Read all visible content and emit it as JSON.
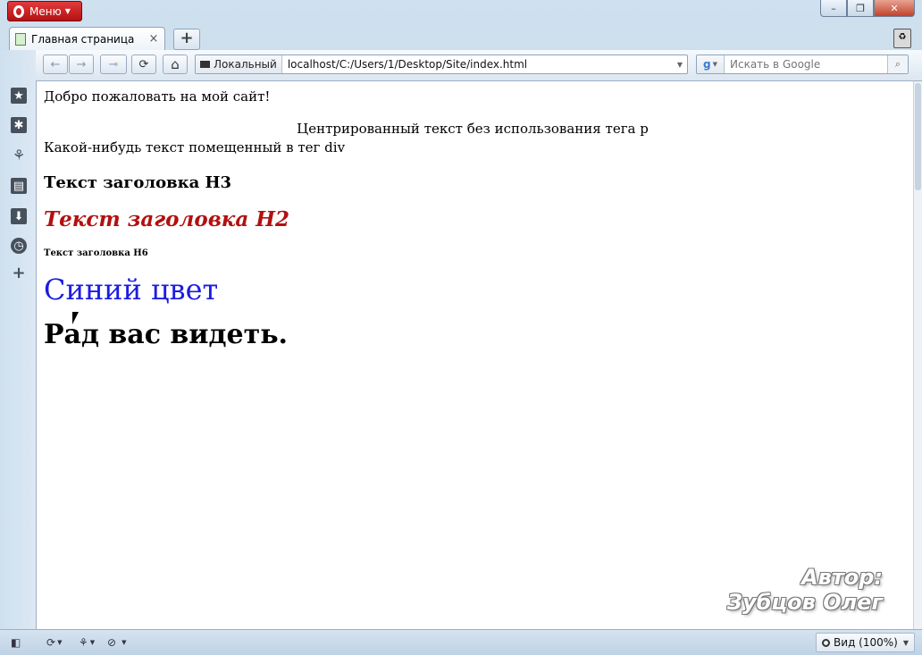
{
  "titlebar": {
    "menu_label": "Меню"
  },
  "window_controls": {
    "minimize": "–",
    "restore": "❐",
    "close": "✕"
  },
  "tabs": [
    {
      "label": "Главная страница",
      "close": "×"
    }
  ],
  "new_tab_label": "+",
  "toolbar": {
    "back": "←",
    "forward": "→",
    "key": "⊸",
    "reload": "⟳",
    "home": "⌂"
  },
  "address": {
    "security_label": "Локальный",
    "url": "localhost/C:/Users/1/Desktop/Site/index.html",
    "dropdown": "▼"
  },
  "search": {
    "engine_icon": "g",
    "placeholder": "Искать в Google",
    "button": "⌕"
  },
  "sidepanel": {
    "icons": [
      "bookmarks-icon",
      "widgets-icon",
      "unite-icon",
      "notes-icon",
      "downloads-icon",
      "history-icon",
      "add-panel-icon"
    ]
  },
  "page": {
    "welcome": "Добро пожаловать на мой сайт!",
    "centered": "Центрированный текст без использования тега p",
    "div_text": "Какой-нибудь текст помещенный в тег div",
    "h3": "Текст заголовка H3",
    "h2": "Текст заголовка H2",
    "h6": "Текст заголовка H6",
    "blue": "Синий цвет",
    "big": "Рад вас видеть."
  },
  "watermark": {
    "line1": "Автор:",
    "line2": "Зубцов Олег"
  },
  "statusbar": {
    "zoom_label": "Вид (100%)"
  },
  "colors": {
    "h2": "#b31010",
    "blue_text": "#1c1ce0",
    "menu_button": "#c41a1a"
  }
}
